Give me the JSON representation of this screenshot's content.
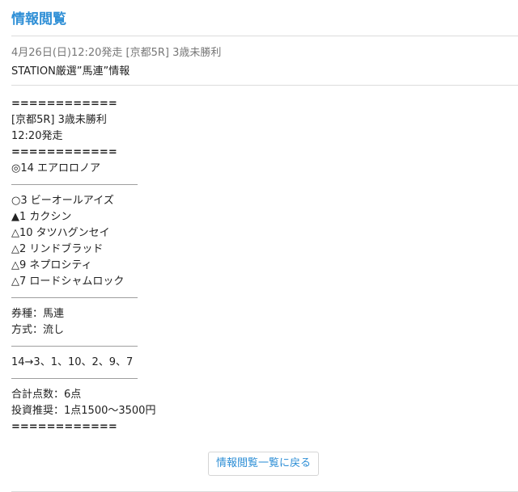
{
  "header": {
    "title": "情報閲覧"
  },
  "info": {
    "meta": "4月26日(日)12:20発走 [京都5R] 3歳未勝利",
    "subject": "STATION厳選”馬連”情報"
  },
  "body": {
    "lines": [
      {
        "kind": "bold-rule",
        "text": "============"
      },
      {
        "kind": "text",
        "text": "[京都5R] 3歳未勝利"
      },
      {
        "kind": "text",
        "text": "12:20発走"
      },
      {
        "kind": "bold-rule",
        "text": "============"
      },
      {
        "kind": "text",
        "text": "◎14 エアロロノア"
      },
      {
        "kind": "thin-rule",
        "text": "――――――――――――"
      },
      {
        "kind": "text",
        "text": "○3 ビーオールアイズ"
      },
      {
        "kind": "text",
        "text": "▲1 カクシン"
      },
      {
        "kind": "text",
        "text": "△10 タツハグンセイ"
      },
      {
        "kind": "text",
        "text": "△2 リンドブラッド"
      },
      {
        "kind": "text",
        "text": "△9 ネプロシティ"
      },
      {
        "kind": "text",
        "text": "△7 ロードシャムロック"
      },
      {
        "kind": "thin-rule",
        "text": "――――――――――――"
      },
      {
        "kind": "text",
        "text": "券種：馬連"
      },
      {
        "kind": "text",
        "text": "方式：流し"
      },
      {
        "kind": "thin-rule",
        "text": "――――――――――――"
      },
      {
        "kind": "text",
        "text": "14→3、1、10、2、9、7"
      },
      {
        "kind": "thin-rule",
        "text": "――――――――――――"
      },
      {
        "kind": "text",
        "text": "合計点数：6点"
      },
      {
        "kind": "text",
        "text": "投資推奨：1点1500～3500円"
      },
      {
        "kind": "bold-rule",
        "text": "============"
      }
    ]
  },
  "footer": {
    "back_label": "情報閲覧一覧に戻る"
  },
  "colors": {
    "accent": "#2f8fd6",
    "rule": "#dcdcdc",
    "meta_text": "#777777"
  }
}
